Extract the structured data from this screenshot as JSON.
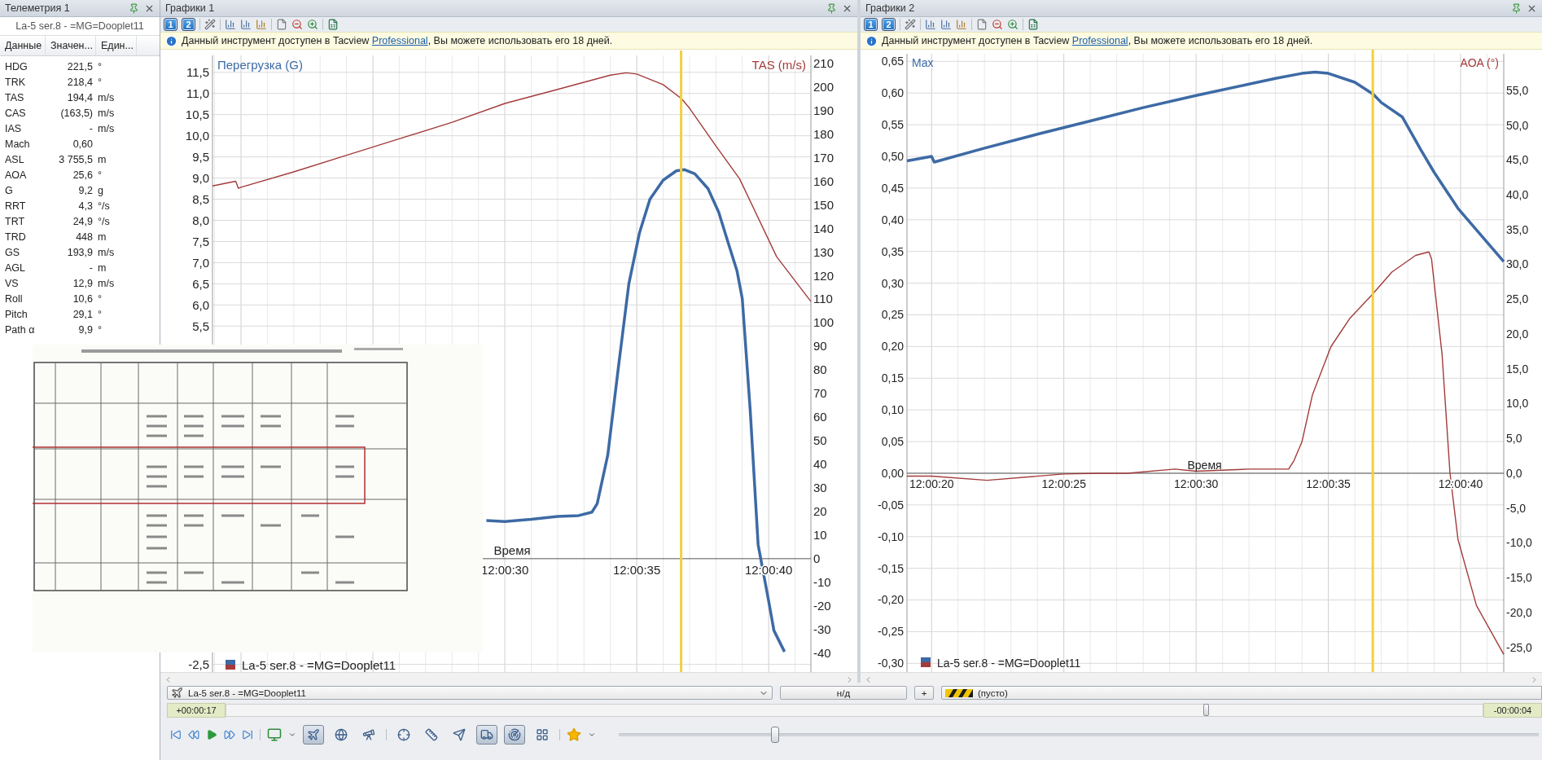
{
  "telemetry": {
    "title": "Телеметрия 1",
    "subtitle": "La-5 ser.8 - =MG=Dooplet11",
    "columns": [
      "Данные",
      "Значен...",
      "Един..."
    ],
    "rows": [
      {
        "name": "HDG",
        "value": "221,5",
        "unit": "°"
      },
      {
        "name": "TRK",
        "value": "218,4",
        "unit": "°"
      },
      {
        "name": "TAS",
        "value": "194,4",
        "unit": "m/s"
      },
      {
        "name": "CAS",
        "value": "(163,5)",
        "unit": "m/s"
      },
      {
        "name": "IAS",
        "value": "-",
        "unit": "m/s"
      },
      {
        "name": "Mach",
        "value": "0,60"
      },
      {
        "name": "ASL",
        "value": "3 755,5",
        "unit": "m"
      },
      {
        "name": "AOA",
        "value": "25,6",
        "unit": "°"
      },
      {
        "name": "G",
        "value": "9,2",
        "unit": "g"
      },
      {
        "name": "RRT",
        "value": "4,3",
        "unit": "°/s"
      },
      {
        "name": "TRT",
        "value": "24,9",
        "unit": "°/s"
      },
      {
        "name": "TRD",
        "value": "448",
        "unit": "m"
      },
      {
        "name": "GS",
        "value": "193,9",
        "unit": "m/s"
      },
      {
        "name": "AGL",
        "value": "-",
        "unit": "m"
      },
      {
        "name": "VS",
        "value": "12,9",
        "unit": "m/s"
      },
      {
        "name": "Roll",
        "value": "10,6",
        "unit": "°"
      },
      {
        "name": "Pitch",
        "value": "29,1",
        "unit": "°"
      },
      {
        "name": "Path α",
        "value": "9,9",
        "unit": "°"
      }
    ]
  },
  "graphs": [
    {
      "title": "Графики 1",
      "toolbar_buttons": [
        {
          "label": "1",
          "selected": true
        },
        {
          "label": "2",
          "selected": true
        }
      ],
      "notice": {
        "text_before": "Данный инструмент доступен в Tacview ",
        "link": "Professional",
        "text_after": ", Вы можете использовать его 18 дней."
      },
      "legend": "La-5 ser.8 - =MG=Dooplet11",
      "chart_data": {
        "type": "line",
        "grid": true,
        "xlabel": "Время",
        "xlim": [
          43218.92,
          43241.6
        ],
        "ylim": [
          -2.68,
          11.9
        ],
        "y2lim": [
          -48.2,
          213.4
        ],
        "ref_lines": [
          {
            "axis": "x",
            "value": 43236.68,
            "color": "#f3d03e"
          }
        ],
        "xticks": [
          {
            "value": 43230,
            "label": "12:00:30"
          },
          {
            "value": 43235,
            "label": "12:00:35"
          },
          {
            "value": 43240,
            "label": "12:00:40"
          }
        ],
        "yticks": [
          {
            "value": 11.5,
            "label": "11,5"
          },
          {
            "value": 11,
            "label": "11,0"
          },
          {
            "value": 10.5,
            "label": "10,5"
          },
          {
            "value": 10,
            "label": "10,0"
          },
          {
            "value": 9.5,
            "label": "9,5"
          },
          {
            "value": 9,
            "label": "9,0"
          },
          {
            "value": 8.5,
            "label": "8,5"
          },
          {
            "value": 8,
            "label": "8,0"
          },
          {
            "value": 7.5,
            "label": "7,5"
          },
          {
            "value": 7,
            "label": "7,0"
          },
          {
            "value": 6.5,
            "label": "6,5"
          },
          {
            "value": 6,
            "label": "6,0"
          },
          {
            "value": 5.5,
            "label": "5,5"
          },
          {
            "value": -2.5,
            "label": "-2,5"
          }
        ],
        "y2ticks": [
          210,
          200,
          190,
          180,
          170,
          160,
          150,
          140,
          130,
          120,
          110,
          100,
          90,
          80,
          70,
          60,
          50,
          40,
          30,
          20,
          10,
          0,
          -10,
          -20,
          -30,
          -40
        ],
        "series": [
          {
            "name": "Перегрузка (G)",
            "color": "#3d6aa5",
            "x": [
              43229.3,
              43230,
              43231,
              43232,
              43232.8,
              43233.3,
              43233.5,
              43233.9,
              43234.3,
              43234.7,
              43235.1,
              43235.5,
              43236,
              43236.5,
              43236.8,
              43237.2,
              43237.7,
              43238.1,
              43238.5,
              43238.8,
              43239,
              43239.3,
              43239.6,
              43239.7,
              43240,
              43240.2,
              43240.6
            ],
            "values": [
              0.9,
              0.88,
              0.93,
              1,
              1.02,
              1.1,
              1.3,
              2.45,
              4.5,
              6.5,
              7.7,
              8.5,
              8.95,
              9.17,
              9.2,
              9.1,
              8.75,
              8.2,
              7.4,
              6.8,
              6.15,
              3.5,
              0.33,
              0,
              -1,
              -1.7,
              -2.2
            ]
          },
          {
            "name": "TAS (m/s)",
            "color": "#a33b3b",
            "axis": "y2",
            "x": [
              43218.92,
              43219.8,
              43219.9,
              43220,
              43222,
              43224,
              43226,
              43228,
              43230,
              43232,
              43233,
              43234,
              43234.6,
              43235,
              43236,
              43236.7,
              43237,
              43238,
              43238.9,
              43240.3,
              43241.6
            ],
            "values": [
              158,
              160,
              157,
              157.5,
              164,
              171,
              178,
              185,
              193,
              199,
              202,
              205,
              206,
              205.5,
              201,
              195,
              191,
              175,
              161,
              128,
              109
            ]
          }
        ]
      }
    },
    {
      "title": "Графики 2",
      "toolbar_buttons": [
        {
          "label": "1",
          "selected": true
        },
        {
          "label": "2",
          "selected": true
        }
      ],
      "notice": {
        "text_before": "Данный инструмент доступен в Tacview ",
        "link": "Professional",
        "text_after": ", Вы можете использовать его 18 дней."
      },
      "legend": "La-5 ser.8 - =MG=Dooplet11",
      "chart_data": {
        "type": "line",
        "grid": true,
        "xlabel": "Время",
        "xlim": [
          43219.07,
          43241.63
        ],
        "ylim": [
          -0.3137,
          0.662
        ],
        "y2lim": [
          -28.54,
          60.25
        ],
        "ref_lines": [
          {
            "axis": "x",
            "value": 43236.68,
            "color": "#f3d03e"
          }
        ],
        "xticks": [
          {
            "value": 43220,
            "label": "12:00:20"
          },
          {
            "value": 43225,
            "label": "12:00:25"
          },
          {
            "value": 43230,
            "label": "12:00:30"
          },
          {
            "value": 43235,
            "label": "12:00:35"
          },
          {
            "value": 43240,
            "label": "12:00:40"
          }
        ],
        "yticks": [
          {
            "value": 0.65,
            "label": "0,65"
          },
          {
            "value": 0.6,
            "label": "0,60"
          },
          {
            "value": 0.55,
            "label": "0,55"
          },
          {
            "value": 0.5,
            "label": "0,50"
          },
          {
            "value": 0.45,
            "label": "0,45"
          },
          {
            "value": 0.4,
            "label": "0,40"
          },
          {
            "value": 0.35,
            "label": "0,35"
          },
          {
            "value": 0.3,
            "label": "0,30"
          },
          {
            "value": 0.25,
            "label": "0,25"
          },
          {
            "value": 0.2,
            "label": "0,20"
          },
          {
            "value": 0.15,
            "label": "0,15"
          },
          {
            "value": 0.1,
            "label": "0,10"
          },
          {
            "value": 0.05,
            "label": "0,05"
          },
          {
            "value": 0,
            "label": "0,00"
          },
          {
            "value": -0.05,
            "label": "-0,05"
          },
          {
            "value": -0.1,
            "label": "-0,10"
          },
          {
            "value": -0.15,
            "label": "-0,15"
          },
          {
            "value": -0.2,
            "label": "-0,20"
          },
          {
            "value": -0.25,
            "label": "-0,25"
          },
          {
            "value": -0.3,
            "label": "-0,30"
          }
        ],
        "y2ticks": [
          {
            "value": 55,
            "label": "55,0"
          },
          {
            "value": 50,
            "label": "50,0"
          },
          {
            "value": 45,
            "label": "45,0"
          },
          {
            "value": 40,
            "label": "40,0"
          },
          {
            "value": 35,
            "label": "35,0"
          },
          {
            "value": 30,
            "label": "30,0"
          },
          {
            "value": 25,
            "label": "25,0"
          },
          {
            "value": 20,
            "label": "20,0"
          },
          {
            "value": 15,
            "label": "15,0"
          },
          {
            "value": 10,
            "label": "10,0"
          },
          {
            "value": 5,
            "label": "5,0"
          },
          {
            "value": 0,
            "label": "0,0"
          },
          {
            "value": -5,
            "label": "-5,0"
          },
          {
            "value": -10,
            "label": "-10,0"
          },
          {
            "value": -15,
            "label": "-15,0"
          },
          {
            "value": -20,
            "label": "-20,0"
          },
          {
            "value": -25,
            "label": "-25,0"
          }
        ],
        "series": [
          {
            "name": "Max",
            "color": "#3d6aa5",
            "x": [
              43219.07,
              43220,
              43220.1,
              43222,
              43224,
              43226,
              43228,
              43230,
              43232,
              43233,
              43234,
              43234.5,
              43235,
              43236,
              43236.7,
              43237,
              43237.8,
              43238.5,
              43239,
              43239.9,
              43241.63
            ],
            "values": [
              0.493,
              0.5,
              0.491,
              0.513,
              0.535,
              0.556,
              0.577,
              0.596,
              0.614,
              0.623,
              0.631,
              0.633,
              0.631,
              0.617,
              0.598,
              0.585,
              0.562,
              0.51,
              0.475,
              0.418,
              0.334
            ]
          },
          {
            "name": "AOA (°)",
            "color": "#a33b3b",
            "axis": "y2",
            "x": [
              43219.07,
              43220,
              43222.1,
              43225,
              43226.4,
              43227.4,
              43229.2,
              43230,
              43232,
              43233.5,
              43233.7,
              43234,
              43234.4,
              43235.1,
              43235.8,
              43236.67,
              43237.4,
              43238.3,
              43238.8,
              43238.9,
              43239.3,
              43239.6,
              43239.9,
              43240.6,
              43241.63
            ],
            "values": [
              -0.4,
              -0.4,
              -1,
              -0.1,
              0,
              0,
              0.6,
              0.3,
              0.6,
              0.6,
              1.8,
              4.5,
              11.3,
              18.2,
              22.2,
              25.7,
              28.9,
              31.3,
              31.8,
              30.8,
              17,
              0,
              -9.5,
              -19,
              -26
            ]
          }
        ]
      }
    }
  ],
  "bottom_bar": {
    "object_select": "La-5 ser.8 - =MG=Dooplet11",
    "value_button": "н/д",
    "add_button": "+",
    "target_field": "(пусто)",
    "time_elapsed": "+00:00:17",
    "time_remaining": "-00:00:04",
    "timeline": {
      "level": 0.78
    },
    "speed": {
      "level": 0.17
    },
    "view_toggles": [
      {
        "kind": "aircraft",
        "on": true
      },
      {
        "kind": "globe",
        "on": false
      },
      {
        "kind": "telescope",
        "on": false
      }
    ],
    "tool_toggles": [
      {
        "kind": "crosshair",
        "on": false
      },
      {
        "kind": "ruler",
        "on": false
      },
      {
        "kind": "plane",
        "on": false
      },
      {
        "kind": "vehicle",
        "on": true
      },
      {
        "kind": "radar",
        "on": true
      },
      {
        "kind": "grid",
        "on": false
      }
    ]
  }
}
